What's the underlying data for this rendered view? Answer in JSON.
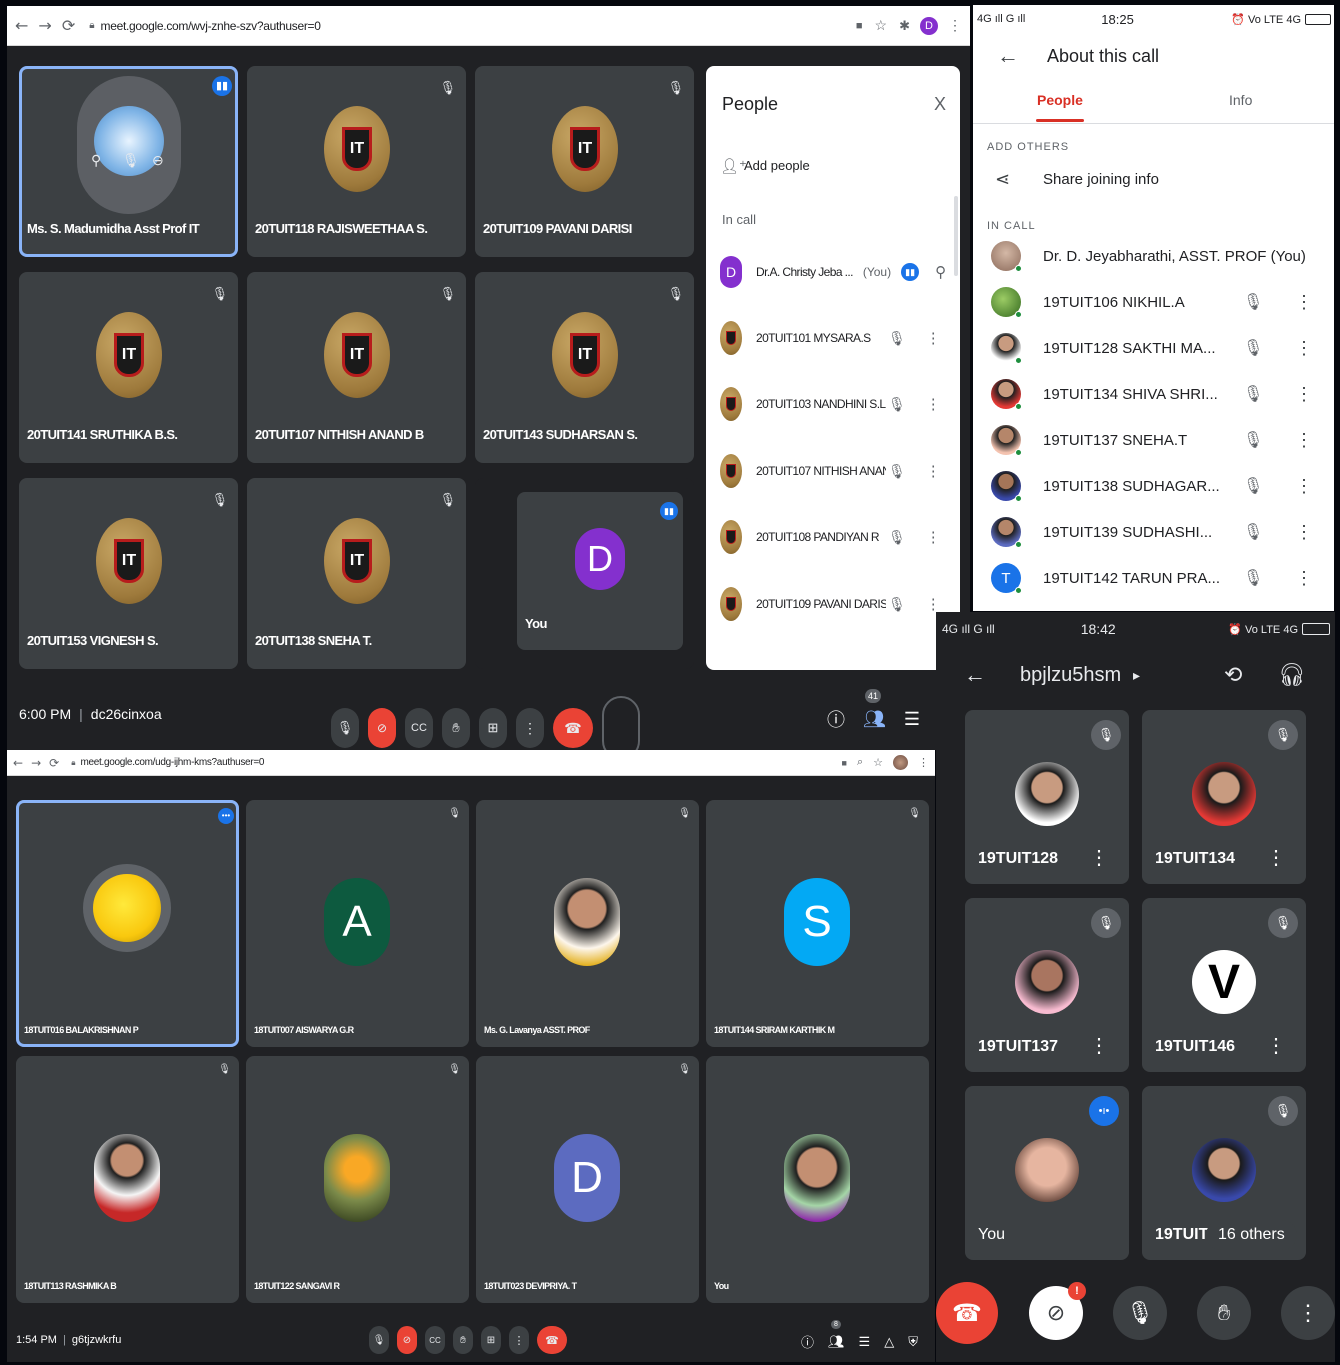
{
  "win1": {
    "url": "meet.google.com/wvj-znhe-szv?authuser=0",
    "profile_initial": "D",
    "tiles": [
      {
        "name": "Ms. S. Madumidha Asst Prof IT"
      },
      {
        "name": "20TUIT118 RAJISWEETHAA S."
      },
      {
        "name": "20TUIT109 PAVANI DARISI"
      },
      {
        "name": "20TUIT141 SRUTHIKA B.S."
      },
      {
        "name": "20TUIT107 NITHISH ANAND B"
      },
      {
        "name": "20TUIT143 SUDHARSAN S."
      },
      {
        "name": "20TUIT153 VIGNESH S."
      },
      {
        "name": "20TUIT138 SNEHA T."
      },
      {
        "name": "You",
        "initial": "D"
      }
    ],
    "time": "6:00 PM",
    "code": "dc26cinxoa",
    "people_count": "41",
    "people": {
      "title": "People",
      "close": "X",
      "add_people": "Add people",
      "in_call": "In call",
      "you": {
        "initial": "D",
        "name": "Dr.A. Christy Jeba ...",
        "you_label": "(You)"
      },
      "rows": [
        "20TUIT101 MYSARA.S",
        "20TUIT103 NANDHINI S.L.",
        "20TUIT107 NITHISH ANAN...",
        "20TUIT108 PANDIYAN R",
        "20TUIT109 PAVANI DARISI"
      ]
    }
  },
  "win2": {
    "url": "meet.google.com/udg-ijhm-kms?authuser=0",
    "tiles": [
      {
        "name": "18TUIT016 BALAKRISHNAN P"
      },
      {
        "name": "18TUIT007 AISWARYA G.R",
        "initial": "A"
      },
      {
        "name": "Ms. G. Lavanya ASST. PROF"
      },
      {
        "name": "18TUIT144 SRIRAM KARTHIK M",
        "initial": "S"
      },
      {
        "name": "18TUIT113 RASHMIKA B"
      },
      {
        "name": "18TUIT122 SANGAVI R"
      },
      {
        "name": "18TUIT023 DEVIPRIYA. T",
        "initial": "D"
      },
      {
        "name": "You"
      }
    ],
    "time": "1:54 PM",
    "code": "g6tjzwkrfu",
    "people_count": "8"
  },
  "phone1": {
    "status_left": "4G ıll  G ıll",
    "time": "18:25",
    "status_right": "⏰ Vo LTE 4G",
    "title": "About this call",
    "tabs": [
      "People",
      "Info"
    ],
    "add_others": "ADD OTHERS",
    "share": "Share joining info",
    "in_call": "IN CALL",
    "host": "Dr. D. Jeyabharathi, ASST. PROF (You)",
    "rows": [
      {
        "name": "19TUIT106 NIKHIL.A"
      },
      {
        "name": "19TUIT128 SAKTHI MA..."
      },
      {
        "name": "19TUIT134 SHIVA SHRI..."
      },
      {
        "name": "19TUIT137 SNEHA.T"
      },
      {
        "name": "19TUIT138 SUDHAGAR..."
      },
      {
        "name": "19TUIT139 SUDHASHI..."
      },
      {
        "name": "19TUIT142 TARUN PRA...",
        "initial": "T"
      }
    ]
  },
  "phone2": {
    "status_left": "4G ıll  G ıll",
    "time": "18:42",
    "status_right": "⏰ Vo LTE 4G",
    "meeting": "bpjlzu5hsm",
    "tiles": [
      {
        "name": "19TUIT128"
      },
      {
        "name": "19TUIT134"
      },
      {
        "name": "19TUIT137"
      },
      {
        "name": "19TUIT146",
        "initial": "V"
      },
      {
        "name": "You"
      },
      {
        "name": "19TUIT1"
      }
    ],
    "others": "16 others",
    "badge": "!"
  },
  "colors": {
    "meet_bg": "#202124",
    "tile": "#3c4043",
    "end_red": "#ea4335",
    "link_red": "#d93025",
    "blue": "#1a73e8",
    "purple": "#8430ce"
  }
}
